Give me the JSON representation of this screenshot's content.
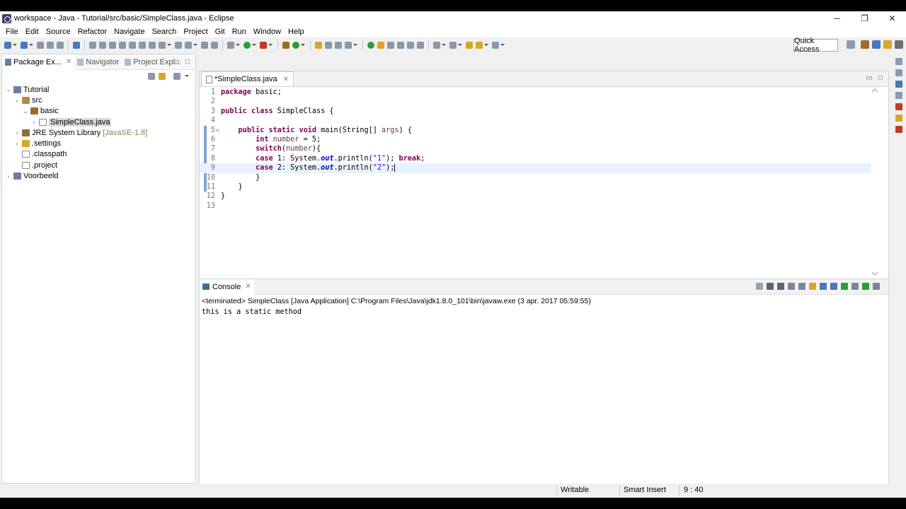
{
  "window": {
    "title": "workspace - Java - Tutorial/src/basic/SimpleClass.java - Eclipse",
    "minimize": "─",
    "restore": "❐",
    "close": "✕"
  },
  "menu": [
    "File",
    "Edit",
    "Source",
    "Refactor",
    "Navigate",
    "Search",
    "Project",
    "Git",
    "Run",
    "Window",
    "Help"
  ],
  "toolbar": {
    "quick_access": "Quick Access"
  },
  "left_panel": {
    "tabs": [
      {
        "label": "Package Ex...",
        "close": "✕"
      },
      {
        "label": "Navigator"
      },
      {
        "label": "Project Expl..."
      }
    ],
    "tree": [
      {
        "label": "Tutorial",
        "arrow": "⌄"
      },
      {
        "label": "src",
        "arrow": "⌄"
      },
      {
        "label": "basic",
        "arrow": "⌄"
      },
      {
        "label": "SimpleClass.java",
        "arrow": "›"
      },
      {
        "label": "JRE System Library",
        "extra": "[JavaSE-1.8]",
        "arrow": "›"
      },
      {
        "label": ".settings",
        "arrow": "›"
      },
      {
        "label": ".classpath",
        "arrow": ""
      },
      {
        "label": ".project",
        "arrow": ""
      },
      {
        "label": "Voorbeeld",
        "arrow": "›"
      }
    ]
  },
  "editor": {
    "tab": {
      "label": "*SimpleClass.java",
      "close": "✕"
    },
    "current_line": 9,
    "lines": [
      {
        "n": "1",
        "tokens": [
          [
            "kw",
            "package"
          ],
          [
            "",
            " basic;"
          ]
        ]
      },
      {
        "n": "2",
        "tokens": []
      },
      {
        "n": "3",
        "tokens": [
          [
            "kw",
            "public"
          ],
          [
            "",
            " "
          ],
          [
            "kw",
            "class"
          ],
          [
            "",
            " SimpleClass {"
          ]
        ]
      },
      {
        "n": "4",
        "tokens": []
      },
      {
        "n": "5",
        "fold": "⊖",
        "tokens": [
          [
            "",
            "    "
          ],
          [
            "kw",
            "public"
          ],
          [
            "",
            " "
          ],
          [
            "kw",
            "static"
          ],
          [
            "",
            " "
          ],
          [
            "kw",
            "void"
          ],
          [
            "",
            " main(String[] "
          ],
          [
            "var",
            "args"
          ],
          [
            "",
            ") {"
          ]
        ]
      },
      {
        "n": "6",
        "tokens": [
          [
            "",
            "        "
          ],
          [
            "kw",
            "int"
          ],
          [
            "",
            " "
          ],
          [
            "var",
            "number"
          ],
          [
            "",
            " = 5;"
          ]
        ]
      },
      {
        "n": "7",
        "tokens": [
          [
            "",
            "        "
          ],
          [
            "kw",
            "switch"
          ],
          [
            "",
            "("
          ],
          [
            "var",
            "number"
          ],
          [
            "",
            "){"
          ]
        ]
      },
      {
        "n": "8",
        "tokens": [
          [
            "",
            "        "
          ],
          [
            "kw",
            "case"
          ],
          [
            "",
            " 1: System."
          ],
          [
            "fld",
            "out"
          ],
          [
            "",
            ".println("
          ],
          [
            "str",
            "\"1\""
          ],
          [
            "",
            "); "
          ],
          [
            "kw",
            "break"
          ],
          [
            "",
            ";"
          ]
        ]
      },
      {
        "n": "9",
        "tokens": [
          [
            "",
            "        "
          ],
          [
            "kw",
            "case"
          ],
          [
            "",
            " 2: System."
          ],
          [
            "fld",
            "out"
          ],
          [
            "",
            ".println("
          ],
          [
            "str",
            "\"2\""
          ],
          [
            "",
            ");"
          ]
        ]
      },
      {
        "n": "10",
        "tokens": [
          [
            "",
            "        }"
          ]
        ]
      },
      {
        "n": "11",
        "tokens": [
          [
            "",
            "    }"
          ]
        ]
      },
      {
        "n": "12",
        "tokens": [
          [
            "",
            "}"
          ]
        ]
      },
      {
        "n": "13",
        "tokens": []
      }
    ]
  },
  "console": {
    "tab": {
      "label": "Console",
      "close": "✕"
    },
    "status": "<terminated> SimpleClass [Java Application] C:\\Program Files\\Java\\jdk1.8.0_101\\bin\\javaw.exe (3 apr. 2017 05:59:55)",
    "output": "this is a static method"
  },
  "statusbar": {
    "writable": "Writable",
    "insert_mode": "Smart Insert",
    "position": "9 : 40"
  }
}
